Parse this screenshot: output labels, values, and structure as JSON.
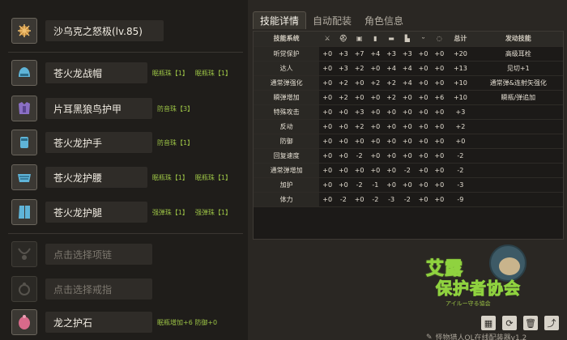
{
  "weapon": {
    "name": "沙乌克之怒极(lv.85)",
    "icon": "weapon-icon"
  },
  "armor": [
    {
      "key": "head",
      "name": "苍火龙战帽",
      "decorations": [
        "眠瓶珠【1】",
        "眠瓶珠【1】"
      ],
      "icon": "helm-icon",
      "color": "#5fb4d8"
    },
    {
      "key": "chest",
      "name": "片耳黑狼鸟护甲",
      "decorations": [
        "防音珠【3】"
      ],
      "icon": "chest-icon",
      "color": "#8a6fc4"
    },
    {
      "key": "arms",
      "name": "苍火龙护手",
      "decorations": [
        "防音珠【1】"
      ],
      "icon": "gauntlet-icon",
      "color": "#5fb4d8"
    },
    {
      "key": "waist",
      "name": "苍火龙护腰",
      "decorations": [
        "眠瓶珠【1】",
        "眠瓶珠【1】"
      ],
      "icon": "waist-icon",
      "color": "#5fb4d8"
    },
    {
      "key": "legs",
      "name": "苍火龙护腿",
      "decorations": [
        "强弹珠【1】",
        "强弹珠【1】"
      ],
      "icon": "greaves-icon",
      "color": "#5fb4d8"
    }
  ],
  "necklace": {
    "placeholder": "点击选择项链"
  },
  "ring": {
    "placeholder": "点击选择戒指"
  },
  "charm": {
    "name": "龙之护石",
    "skills": "眠瓶增加+6 防御+0"
  },
  "tabs": [
    {
      "label": "技能详情",
      "active": true
    },
    {
      "label": "自动配装",
      "active": false
    },
    {
      "label": "角色信息",
      "active": false
    }
  ],
  "table": {
    "headers": {
      "skill": "技能系统",
      "total": "总计",
      "effect": "发动技能"
    },
    "slot_icons": [
      "weapon-icon",
      "helm-icon",
      "chest-icon",
      "gauntlet-icon",
      "waist-icon",
      "greaves-icon",
      "necklace-icon",
      "ring-icon",
      "charm-icon"
    ],
    "rows": [
      {
        "skill": "听觉保护",
        "values": [
          "+0",
          "+3",
          "+7",
          "+4",
          "+3",
          "+3",
          "+0",
          "+0"
        ],
        "total": "+20",
        "effect": "高级耳栓"
      },
      {
        "skill": "达人",
        "values": [
          "+0",
          "+3",
          "+2",
          "+0",
          "+4",
          "+4",
          "+0",
          "+0"
        ],
        "total": "+13",
        "effect": "见切+1"
      },
      {
        "skill": "通常弹强化",
        "values": [
          "+0",
          "+2",
          "+0",
          "+2",
          "+2",
          "+4",
          "+0",
          "+0"
        ],
        "total": "+10",
        "effect": "通常弹&连射矢强化"
      },
      {
        "skill": "瞬弹增加",
        "values": [
          "+0",
          "+2",
          "+0",
          "+0",
          "+2",
          "+0",
          "+0",
          "+6"
        ],
        "total": "+10",
        "effect": "瞬瓶/弹追加"
      },
      {
        "skill": "特殊攻击",
        "values": [
          "+0",
          "+0",
          "+3",
          "+0",
          "+0",
          "+0",
          "+0",
          "+0"
        ],
        "total": "+3",
        "effect": ""
      },
      {
        "skill": "反动",
        "values": [
          "+0",
          "+0",
          "+2",
          "+0",
          "+0",
          "+0",
          "+0",
          "+0"
        ],
        "total": "+2",
        "effect": ""
      },
      {
        "skill": "防御",
        "values": [
          "+0",
          "+0",
          "+0",
          "+0",
          "+0",
          "+0",
          "+0",
          "+0"
        ],
        "total": "+0",
        "effect": ""
      },
      {
        "skill": "回复速度",
        "values": [
          "+0",
          "+0",
          "-2",
          "+0",
          "+0",
          "+0",
          "+0",
          "+0"
        ],
        "total": "-2",
        "effect": ""
      },
      {
        "skill": "通常弹增加",
        "values": [
          "+0",
          "+0",
          "+0",
          "+0",
          "+0",
          "-2",
          "+0",
          "+0"
        ],
        "total": "-2",
        "effect": ""
      },
      {
        "skill": "加护",
        "values": [
          "+0",
          "+0",
          "-2",
          "-1",
          "+0",
          "+0",
          "+0",
          "+0"
        ],
        "total": "-3",
        "effect": ""
      },
      {
        "skill": "体力",
        "values": [
          "+0",
          "-2",
          "+0",
          "-2",
          "-3",
          "-2",
          "+0",
          "+0"
        ],
        "total": "-9",
        "effect": ""
      }
    ]
  },
  "logo": {
    "line1": "艾露",
    "line2": "保护者协会",
    "sub": "アイルー守る協会"
  },
  "toolbar": {
    "buttons": [
      "save-icon",
      "refresh-icon",
      "delete-icon",
      "share-icon"
    ]
  },
  "footer": {
    "text": "怪物猎人OL在线配装器v1.2"
  }
}
